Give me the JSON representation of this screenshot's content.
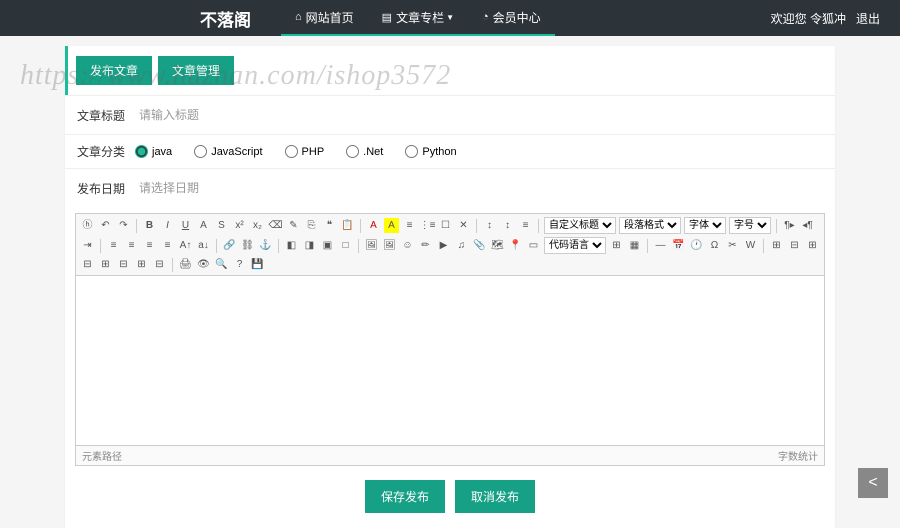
{
  "brand": "不落阁",
  "nav": {
    "home": "网站首页",
    "column": "文章专栏",
    "member": "会员中心"
  },
  "user": {
    "welcome": "欢迎您 令狐冲",
    "logout": "退出"
  },
  "tabs": {
    "publish": "发布文章",
    "manage": "文章管理"
  },
  "form": {
    "title_label": "文章标题",
    "title_placeholder": "请输入标题",
    "category_label": "文章分类",
    "date_label": "发布日期",
    "date_placeholder": "请选择日期"
  },
  "categories": [
    {
      "label": "java",
      "checked": true
    },
    {
      "label": "JavaScript",
      "checked": false
    },
    {
      "label": "PHP",
      "checked": false
    },
    {
      "label": ".Net",
      "checked": false
    },
    {
      "label": "Python",
      "checked": false
    }
  ],
  "editor": {
    "selects": {
      "custom_title": "自定义标题",
      "para_format": "段落格式",
      "font": "字体",
      "size": "字号"
    },
    "code_lang": "代码语言",
    "path_label": "元素路径",
    "wordcount": "字数统计"
  },
  "actions": {
    "save": "保存发布",
    "cancel": "取消发布"
  },
  "watermark": "https://www.huzhan.com/ishop3572",
  "colors": {
    "accent": "#16a085"
  }
}
